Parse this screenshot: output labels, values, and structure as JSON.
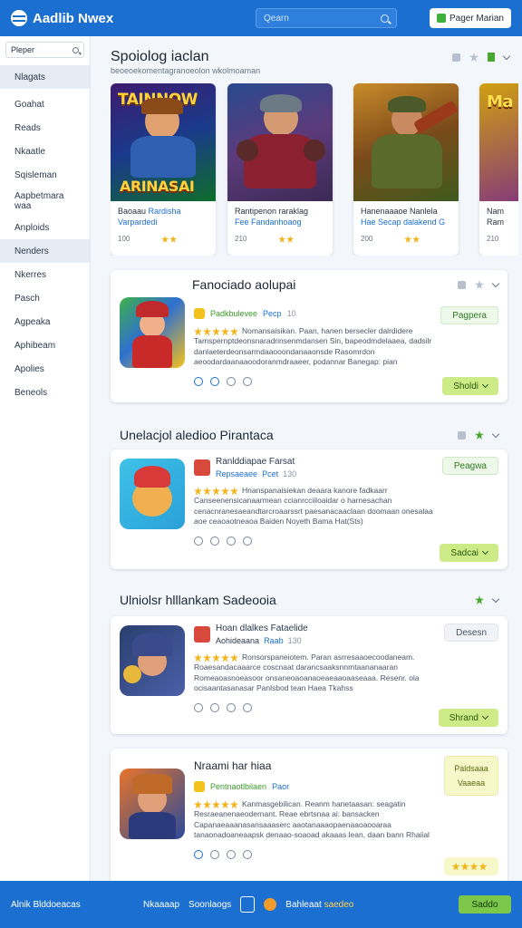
{
  "header": {
    "logo_text": "Aadlib Nwex",
    "search_placeholder": "Qearn",
    "right_button": "Pager Marian"
  },
  "sidebar": {
    "search_value": "Pleper",
    "items": [
      {
        "label": "Nlagats",
        "active": true
      },
      {
        "label": "Goahat"
      },
      {
        "label": "Reads"
      },
      {
        "label": "Nkaatle"
      },
      {
        "label": "Sqisleman"
      },
      {
        "label": "Aapbetmara waa"
      },
      {
        "label": "Anploids"
      },
      {
        "label": "Nenders",
        "active": true
      },
      {
        "label": "Nkerres"
      },
      {
        "label": "Pasch"
      },
      {
        "label": "Agpeaka"
      },
      {
        "label": "Aphibeam"
      },
      {
        "label": "Apolies"
      },
      {
        "label": "Beneols"
      }
    ]
  },
  "featured": {
    "title": "Spoiolog iaclan",
    "subtitle": "beoeoekomentagranoeolon wkolmoaman",
    "cards": [
      {
        "art_title_top": "TAINNOW",
        "art_title_bottom": "ARINASAI",
        "line1": "Baoaau",
        "line1_hl": "Rardisha",
        "line2": "Varpardedi",
        "count": "100"
      },
      {
        "art_title_top": "",
        "art_title_bottom": "",
        "line1": "Rantipenon raraklag",
        "line1_hl": "",
        "line2": "Fee Fandanhoaog",
        "count": "210"
      },
      {
        "art_title_top": "",
        "art_title_bottom": "",
        "line1": "Hanenaaaoe Nanlela",
        "line1_hl": "",
        "line2": "Hae Secap dalakend G",
        "count": "200"
      },
      {
        "art_title_top": "Ma",
        "art_title_bottom": "",
        "line1": "Nam",
        "line1_hl": "",
        "line2": "Ram",
        "count": "210"
      }
    ]
  },
  "sections": [
    {
      "title": "Fanociado aolupai",
      "app_name": "",
      "dev_name": "Padkbulevee",
      "dev_tag": "Pecp",
      "dev_count": "10",
      "desc": "Nomansaisikan. Paan, hanen bersecler dalrdidere Tamspernptdeonsnaradrinsenmdansen Sin, bapeodmdelaaea, dadsilr danlaeterdeonsarmdaaooondanaaonsde Rasomrdon aeoodardaanaaoodoranmdraaeer, podannar Banegap: pian",
      "button_outline": "Pagpera",
      "button_solid": "Sholdi"
    },
    {
      "title": "Unelacjol aledioo Pirantaca",
      "app_name": "Ranlddiapae Farsat",
      "dev_name": "Repsaeaee",
      "dev_tag": "Pcet",
      "dev_count": "130",
      "desc": "Hnanspanaisiekan deaara kanore fadkaarr Canseenensicanaarmean ccianrcciiloaidar o harnesachan cenacnranesaeandtarcroaarssrt paesanacaaclaan doomaan onesalaa aoe ceaoaotneaoa Baiden Noyeth Bama Hat(Sts)",
      "button_outline": "Peagwa",
      "button_solid": "Sadcai"
    },
    {
      "title": "Ulniolsr hlllankam Sadeooia",
      "app_name": "Hoan dlalkes Fataelide",
      "dev_name": "Aohideaana",
      "dev_tag": "Raab",
      "dev_count": "130",
      "desc": "Ronsorspaneiotem. Paran asrresaaoecoodaneam. Roaesandacaaarce coscnaat darancsaaksnnmtaananaaran Romeaoasnoeasoor onsaneoaoanaoeaeaaoaaseaaa. Resenr. ola ocisaantasanasar Panlsbod tean Haea Tkahss",
      "button_outline": "Desesn",
      "button_solid": "Shrand"
    },
    {
      "title": "",
      "app_name": "Nraami har hiaa",
      "dev_name": "Pentnaotlbilaen",
      "dev_tag": "Paor",
      "dev_count": "",
      "desc": "Kanmasgebilican. Reanm hanetaasan: seagatin Resraeanenaeodernant. Reae ebrtsnaa ai: bansacken Capanaeaaanasansaaaserc aaotanaaaopaenaaoaooaraa tanaonadoaneaapsk denaao-soaoad akaaas lean, daan bann Rhaiial",
      "yellow_top": "Paldsaaa",
      "yellow_bottom": "Vaaeaa"
    }
  ],
  "footer": {
    "left": "Alnik Blddoeacas",
    "mid1": "Nkaaaap",
    "mid2": "Soonlaogs",
    "mid3": "Bahleaat",
    "mid_accent": "saedeo",
    "button": "Saddo"
  }
}
